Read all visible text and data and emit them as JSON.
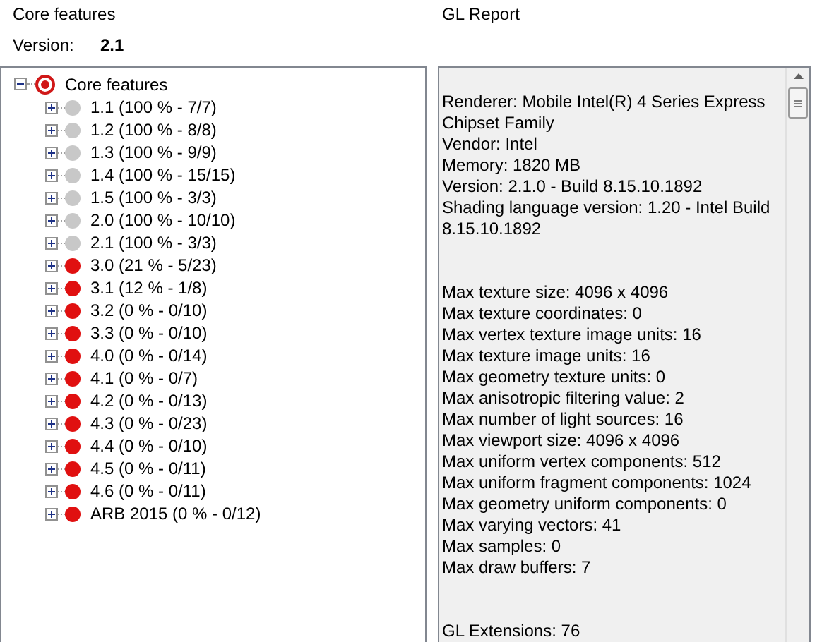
{
  "left_panel": {
    "title": "Core features",
    "version_label": "Version:",
    "version_value": "2.1",
    "tree": {
      "label": "Core features",
      "kind": "root",
      "expanded": true,
      "children": [
        {
          "label": "1.1 (100 % - 7/7)",
          "color": "#c8c8c8",
          "expanded": false
        },
        {
          "label": "1.2 (100 % - 8/8)",
          "color": "#c8c8c8",
          "expanded": false
        },
        {
          "label": "1.3 (100 % - 9/9)",
          "color": "#c8c8c8",
          "expanded": false
        },
        {
          "label": "1.4 (100 % - 15/15)",
          "color": "#c8c8c8",
          "expanded": false
        },
        {
          "label": "1.5 (100 % - 3/3)",
          "color": "#c8c8c8",
          "expanded": false
        },
        {
          "label": "2.0 (100 % - 10/10)",
          "color": "#c8c8c8",
          "expanded": false
        },
        {
          "label": "2.1 (100 % - 3/3)",
          "color": "#c8c8c8",
          "expanded": false
        },
        {
          "label": "3.0 (21 % - 5/23)",
          "color": "#e01010",
          "expanded": false
        },
        {
          "label": "3.1 (12 % - 1/8)",
          "color": "#e01010",
          "expanded": false
        },
        {
          "label": "3.2 (0 % - 0/10)",
          "color": "#e01010",
          "expanded": false
        },
        {
          "label": "3.3 (0 % - 0/10)",
          "color": "#e01010",
          "expanded": false
        },
        {
          "label": "4.0 (0 % - 0/14)",
          "color": "#e01010",
          "expanded": false
        },
        {
          "label": "4.1 (0 % - 0/7)",
          "color": "#e01010",
          "expanded": false
        },
        {
          "label": "4.2 (0 % - 0/13)",
          "color": "#e01010",
          "expanded": false
        },
        {
          "label": "4.3 (0 % - 0/23)",
          "color": "#e01010",
          "expanded": false
        },
        {
          "label": "4.4 (0 % - 0/10)",
          "color": "#e01010",
          "expanded": false
        },
        {
          "label": "4.5 (0 % - 0/11)",
          "color": "#e01010",
          "expanded": false
        },
        {
          "label": "4.6 (0 % - 0/11)",
          "color": "#e01010",
          "expanded": false
        },
        {
          "label": "ARB 2015 (0 % - 0/12)",
          "color": "#e01010",
          "expanded": false
        }
      ]
    }
  },
  "report": {
    "title": "GL Report",
    "sections": [
      {
        "lines": [
          "Renderer: Mobile Intel(R) 4 Series Express",
          "Chipset Family",
          "Vendor: Intel",
          "Memory: 1820 MB",
          "Version: 2.1.0 - Build 8.15.10.1892",
          "Shading language version: 1.20  - Intel Build",
          "8.15.10.1892"
        ]
      },
      {
        "lines": [
          "Max texture size: 4096 x 4096",
          "Max texture coordinates: 0",
          "Max vertex texture image units: 16",
          "Max texture image units: 16",
          "Max geometry texture units: 0",
          "Max anisotropic filtering value: 2",
          "Max number of light sources: 16",
          "Max viewport size: 4096 x 4096",
          "Max uniform vertex components: 512",
          "Max uniform fragment components: 1024",
          "Max geometry uniform components: 0",
          "Max varying vectors: 41",
          "Max samples: 0",
          "Max draw buffers: 7"
        ]
      },
      {
        "lines": [
          "GL Extensions: 76"
        ]
      }
    ]
  }
}
